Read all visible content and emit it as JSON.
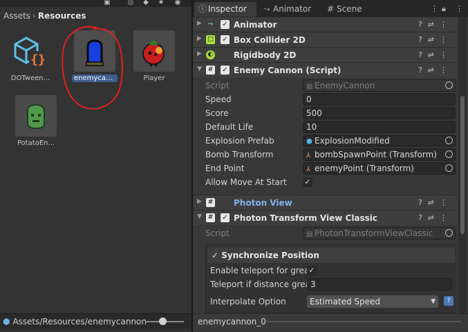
{
  "project": {
    "breadcrumb": [
      "Assets",
      "Resources"
    ],
    "assets": [
      {
        "label": "DOTween...",
        "icon": "dotween-settings-icon"
      },
      {
        "label": "enemycan...",
        "icon": "blue-cannon-prefab-icon",
        "selected": true
      },
      {
        "label": "Player",
        "icon": "tomato-player-prefab-icon"
      },
      {
        "label": "PotatoEn...",
        "icon": "potato-enemy-prefab-icon"
      }
    ],
    "status_path": "Assets/Resources/enemycannon",
    "zoom_level": 0.4
  },
  "inspector": {
    "tabs": [
      {
        "label": "Inspector",
        "icon": "info-icon",
        "active": true
      },
      {
        "label": "Animator",
        "icon": "animator-icon"
      },
      {
        "label": "Scene",
        "icon": "scene-grid-icon"
      }
    ],
    "components": [
      {
        "name": "Animator",
        "icon": "animator-icon",
        "enabled": true,
        "expanded": false
      },
      {
        "name": "Box Collider 2D",
        "icon": "box-collider-icon",
        "enabled": true,
        "expanded": false
      },
      {
        "name": "Rigidbody 2D",
        "icon": "rigidbody-icon",
        "enabled": null,
        "expanded": false
      },
      {
        "name": "Enemy Cannon (Script)",
        "icon": "script-icon",
        "enabled": true,
        "expanded": true
      },
      {
        "name": "Photon View",
        "icon": "script-icon",
        "enabled": null,
        "expanded": false
      },
      {
        "name": "Photon Transform View Classic",
        "icon": "script-icon",
        "enabled": true,
        "expanded": true
      }
    ],
    "enemy_cannon": {
      "script": {
        "label": "Script",
        "value": "EnemyCannon"
      },
      "speed": {
        "label": "Speed",
        "value": "0"
      },
      "score": {
        "label": "Score",
        "value": "500"
      },
      "default_life": {
        "label": "Default Life",
        "value": "10"
      },
      "explosion_prefab": {
        "label": "Explosion Prefab",
        "value": "ExplosionModified"
      },
      "bomb_transform": {
        "label": "Bomb Transform",
        "value": "bombSpawnPoint (Transform)"
      },
      "end_point": {
        "label": "End Point",
        "value": "enemyPoint (Transform)"
      },
      "allow_move_at_start": {
        "label": "Allow Move At Start",
        "value": true
      }
    },
    "photon_transform": {
      "script": {
        "label": "Script",
        "value": "PhotonTransformViewClassic"
      },
      "sync_position": {
        "label": "Synchronize Position",
        "checked": true
      },
      "enable_teleport": {
        "label": "Enable teleport for great d",
        "value": true
      },
      "teleport_distance": {
        "label": "Teleport if distance great",
        "value": "3"
      },
      "interpolate_option": {
        "label": "Interpolate Option",
        "value": "Estimated Speed"
      }
    },
    "status_object": "enemycannon_0"
  },
  "colors": {
    "accent_selection": "#3d5e8e",
    "annotation_circle": "#e02020",
    "link_blue": "#7fb2f0"
  }
}
